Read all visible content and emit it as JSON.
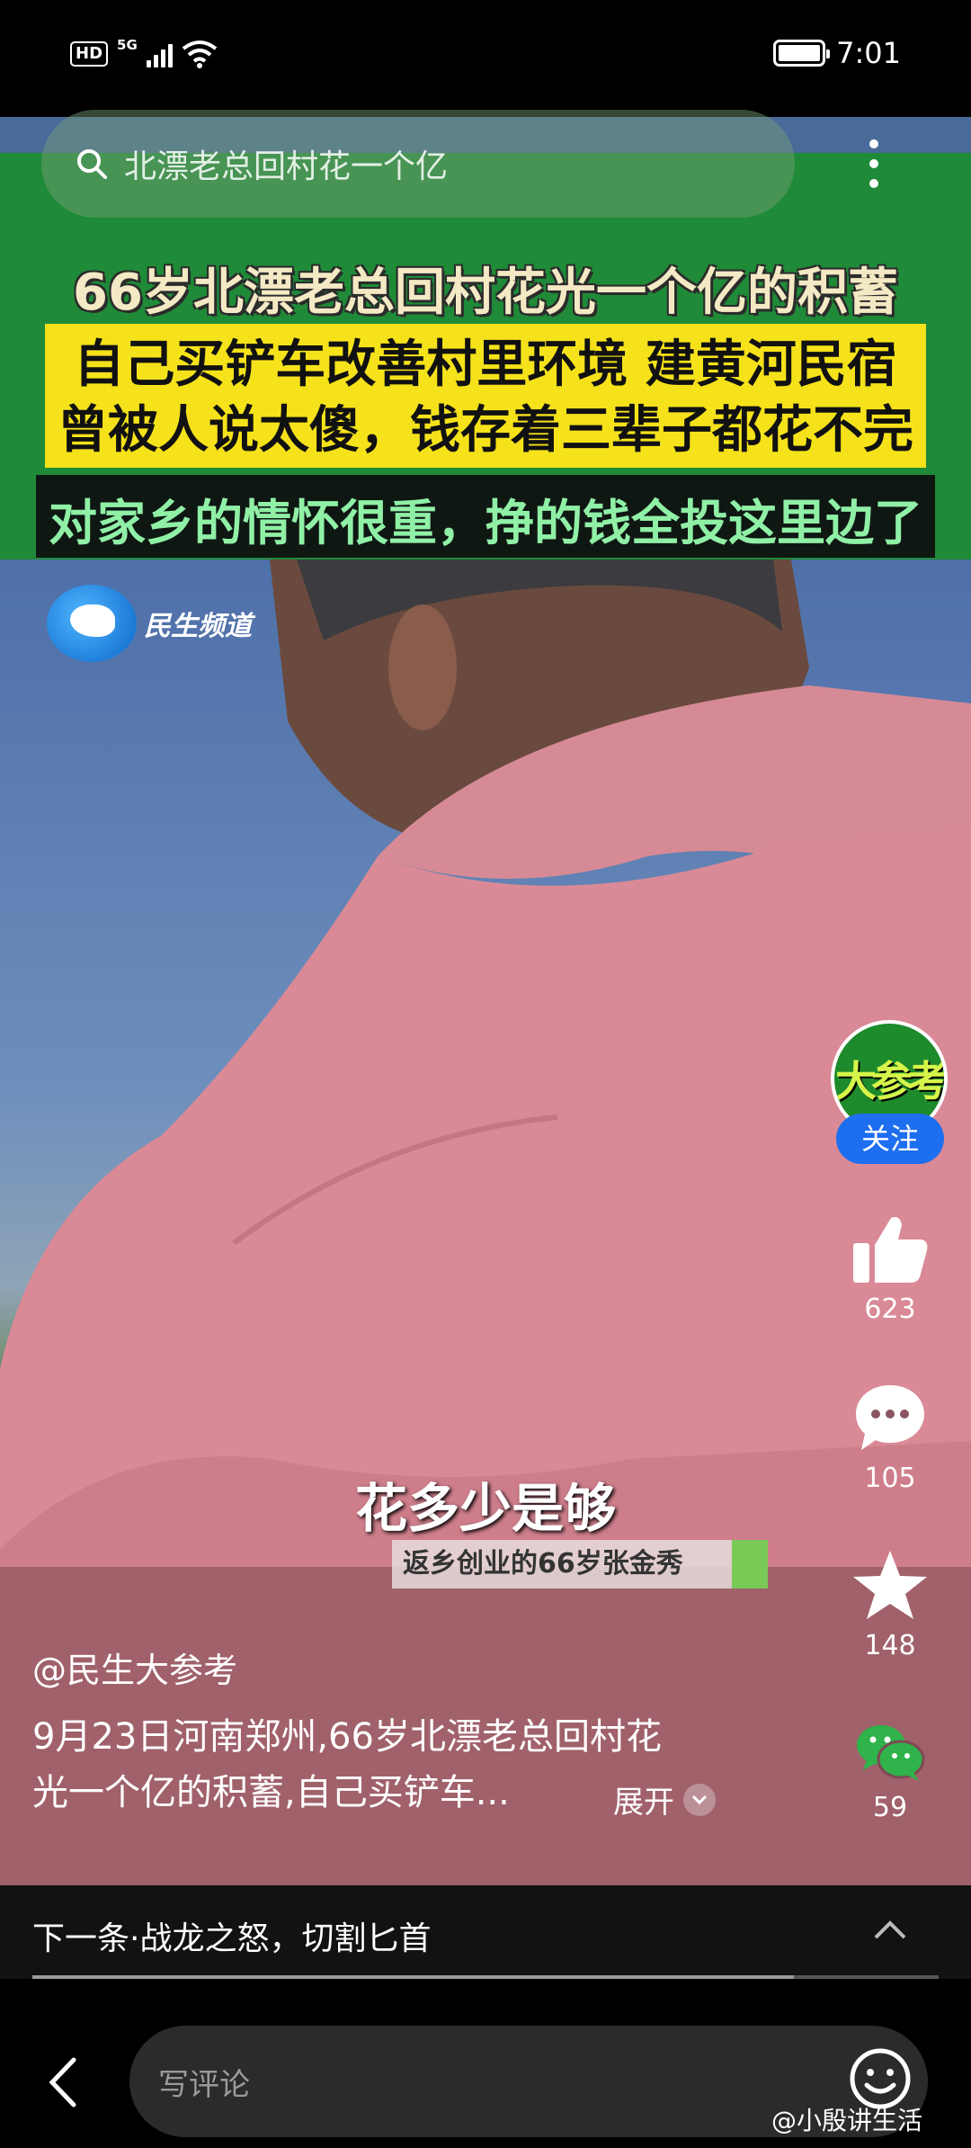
{
  "status_bar": {
    "hd": "HD",
    "network": "5G",
    "time": "7:01",
    "battery_level": 1.0
  },
  "search": {
    "query": "北漂老总回村花一个亿"
  },
  "video": {
    "headline_1": "66岁北漂老总回村花光一个亿的积蓄",
    "headline_2": "自己买铲车改善村里环境 建黄河民宿",
    "headline_3": "曾被人说太傻，钱存着三辈子都花不完",
    "headline_4": "对家乡的情怀很重，挣的钱全投这里边了",
    "channel_name": "民生频道",
    "subtitle": "花多少是够",
    "subtitle_tag": "返乡创业的66岁张金秀"
  },
  "rail": {
    "avatar_text": "大参考",
    "follow_label": "关注",
    "likes": "623",
    "comments": "105",
    "favorites": "148",
    "shares": "59"
  },
  "caption": {
    "author": "@民生大参考",
    "description_line_1": "9月23日河南郑州,66岁北漂老总回村花",
    "description_line_2": "光一个亿的积蓄,自己买铲车...",
    "expand_label": "展开"
  },
  "next": {
    "label": "下一条·战龙之怒，切割匕首"
  },
  "progress": 0.84,
  "comment_bar": {
    "placeholder": "写评论"
  },
  "watermark": "@小殷讲生活",
  "colors": {
    "banner_green": "#1f8a37",
    "headline_yellow": "#f6e21a",
    "follow_blue": "#1e6ef0",
    "wechat_green": "#2fb34a"
  }
}
